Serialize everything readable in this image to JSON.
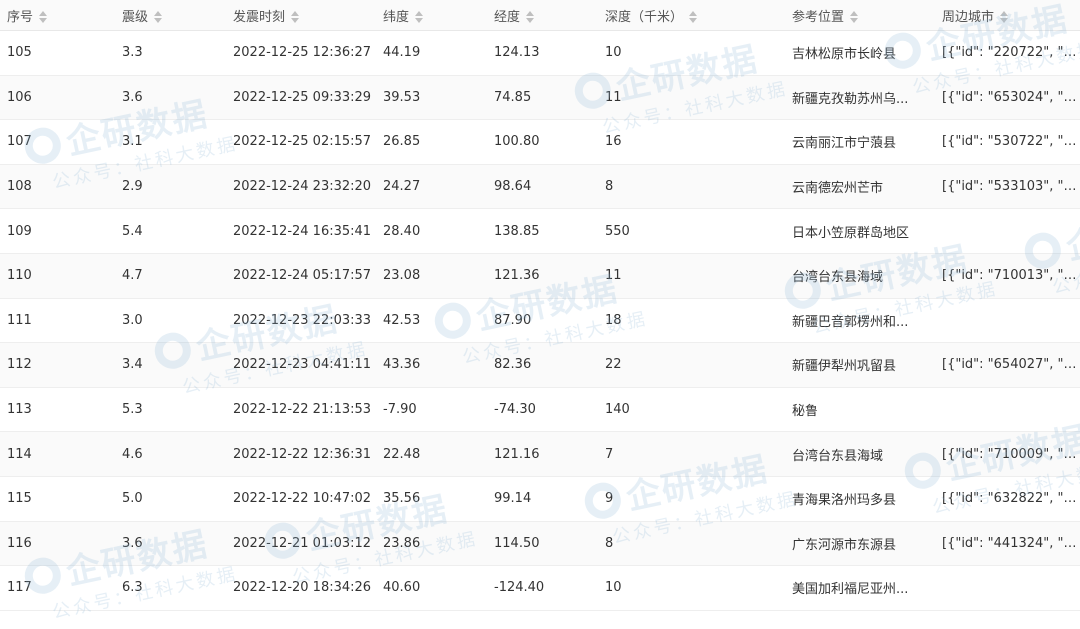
{
  "table": {
    "headers": [
      "序号",
      "震级",
      "发震时刻",
      "纬度",
      "经度",
      "深度（千米）",
      "参考位置",
      "周边城市"
    ],
    "rows": [
      [
        "105",
        "3.3",
        "2022-12-25 12:36:27",
        "44.19",
        "124.13",
        "10",
        "吉林松原市长岭县",
        "[{\"id\": \"220722\", \"na..."
      ],
      [
        "106",
        "3.6",
        "2022-12-25 09:33:29",
        "39.53",
        "74.85",
        "11",
        "新疆克孜勒苏州乌...",
        "[{\"id\": \"653024\", \"na..."
      ],
      [
        "107",
        "3.1",
        "2022-12-25 02:15:57",
        "26.85",
        "100.80",
        "16",
        "云南丽江市宁蒗县",
        "[{\"id\": \"530722\", \"na..."
      ],
      [
        "108",
        "2.9",
        "2022-12-24 23:32:20",
        "24.27",
        "98.64",
        "8",
        "云南德宏州芒市",
        "[{\"id\": \"533103\", \"na..."
      ],
      [
        "109",
        "5.4",
        "2022-12-24 16:35:41",
        "28.40",
        "138.85",
        "550",
        "日本小笠原群岛地区",
        ""
      ],
      [
        "110",
        "4.7",
        "2022-12-24 05:17:57",
        "23.08",
        "121.36",
        "11",
        "台湾台东县海域",
        "[{\"id\": \"710013\", \"na..."
      ],
      [
        "111",
        "3.0",
        "2022-12-23 22:03:33",
        "42.53",
        "87.90",
        "18",
        "新疆巴音郭楞州和...",
        ""
      ],
      [
        "112",
        "3.4",
        "2022-12-23 04:41:11",
        "43.36",
        "82.36",
        "22",
        "新疆伊犁州巩留县",
        "[{\"id\": \"654027\", \"na..."
      ],
      [
        "113",
        "5.3",
        "2022-12-22 21:13:53",
        "-7.90",
        "-74.30",
        "140",
        "秘鲁",
        ""
      ],
      [
        "114",
        "4.6",
        "2022-12-22 12:36:31",
        "22.48",
        "121.16",
        "7",
        "台湾台东县海域",
        "[{\"id\": \"710009\", \"na..."
      ],
      [
        "115",
        "5.0",
        "2022-12-22 10:47:02",
        "35.56",
        "99.14",
        "9",
        "青海果洛州玛多县",
        "[{\"id\": \"632822\", \"na..."
      ],
      [
        "116",
        "3.6",
        "2022-12-21 01:03:12",
        "23.86",
        "114.50",
        "8",
        "广东河源市东源县",
        "[{\"id\": \"441324\", \"na..."
      ],
      [
        "117",
        "6.3",
        "2022-12-20 18:34:26",
        "40.60",
        "-124.40",
        "10",
        "美国加利福尼亚州...",
        ""
      ]
    ]
  },
  "watermark": {
    "brand": "企研数据",
    "caption": "公众号：社科大数据"
  },
  "colors": {
    "header_bg": "#fafafa",
    "row_alt_bg": "#fafafa",
    "border": "#eeeeee",
    "sort_icon": "#bfbfbf",
    "watermark": "#8cb4d7"
  }
}
